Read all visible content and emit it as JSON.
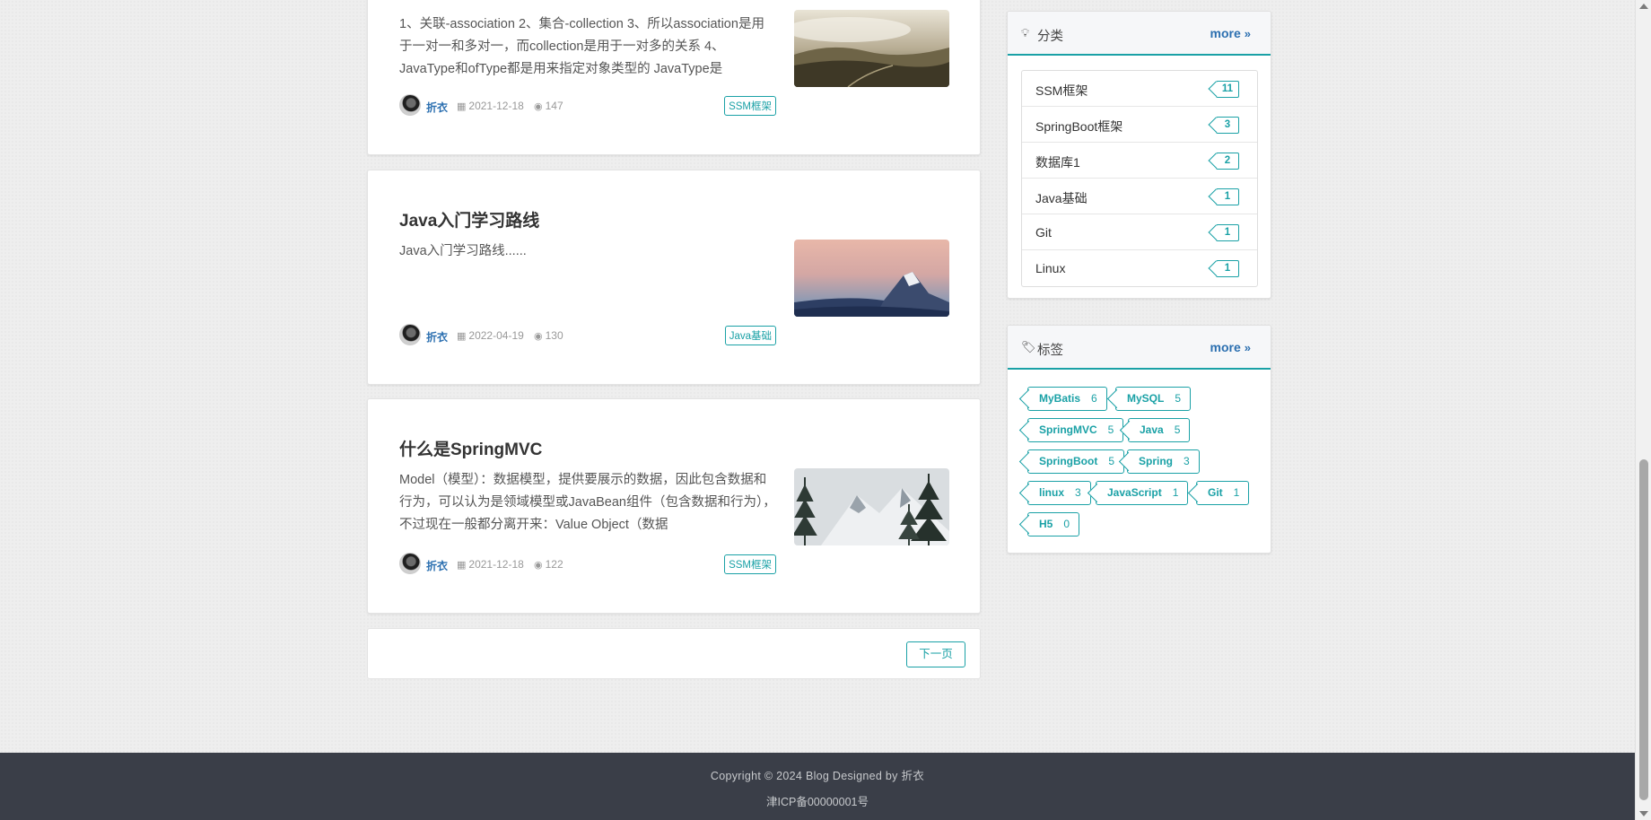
{
  "posts": [
    {
      "title": "",
      "desc": "1、关联-association 2、集合-collection 3、所以association是用于一对一和多对一，而collection是用于一对多的关系 4、JavaType和ofType都是用来指定对象类型的 JavaType是",
      "author": "折衣",
      "date": "2021-12-18",
      "views": "147",
      "category": "SSM框架"
    },
    {
      "title": "Java入门学习路线",
      "desc": "Java入门学习路线......",
      "author": "折衣",
      "date": "2022-04-19",
      "views": "130",
      "category": "Java基础"
    },
    {
      "title": "什么是SpringMVC",
      "desc": "Model（模型）：数据模型，提供要展示的数据，因此包含数据和行为，可以认为是领域模型或JavaBean组件（包含数据和行为），不过现在一般都分离开来：Value Object（数据",
      "author": "折衣",
      "date": "2021-12-18",
      "views": "122",
      "category": "SSM框架"
    }
  ],
  "pager": {
    "next_label": "下一页"
  },
  "categories": {
    "title": "分类",
    "more": "more",
    "items": [
      {
        "name": "SSM框架",
        "count": "11"
      },
      {
        "name": "SpringBoot框架",
        "count": "3"
      },
      {
        "name": "数据库1",
        "count": "2"
      },
      {
        "name": "Java基础",
        "count": "1"
      },
      {
        "name": "Git",
        "count": "1"
      },
      {
        "name": "Linux",
        "count": "1"
      }
    ]
  },
  "tags": {
    "title": "标签",
    "more": "more",
    "items": [
      {
        "name": "MyBatis",
        "count": "6"
      },
      {
        "name": "MySQL",
        "count": "5"
      },
      {
        "name": "SpringMVC",
        "count": "5"
      },
      {
        "name": "Java",
        "count": "5"
      },
      {
        "name": "SpringBoot",
        "count": "5"
      },
      {
        "name": "Spring",
        "count": "3"
      },
      {
        "name": "linux",
        "count": "3"
      },
      {
        "name": "JavaScript",
        "count": "1"
      },
      {
        "name": "Git",
        "count": "1"
      },
      {
        "name": "H5",
        "count": "0"
      }
    ]
  },
  "footer": {
    "copyright": "Copyright © 2024 Blog Designed by 折衣",
    "icp": "津ICP备00000001号"
  },
  "icons": {
    "category_head": "lightbulb-icon",
    "tag_head": "tags-icon",
    "more": "double-chevron-right-icon",
    "date": "calendar-icon",
    "views": "eye-icon"
  },
  "colors": {
    "accent": "#1aa1a6",
    "link": "#2b6fb0",
    "footer_bg": "#3a3e48"
  }
}
